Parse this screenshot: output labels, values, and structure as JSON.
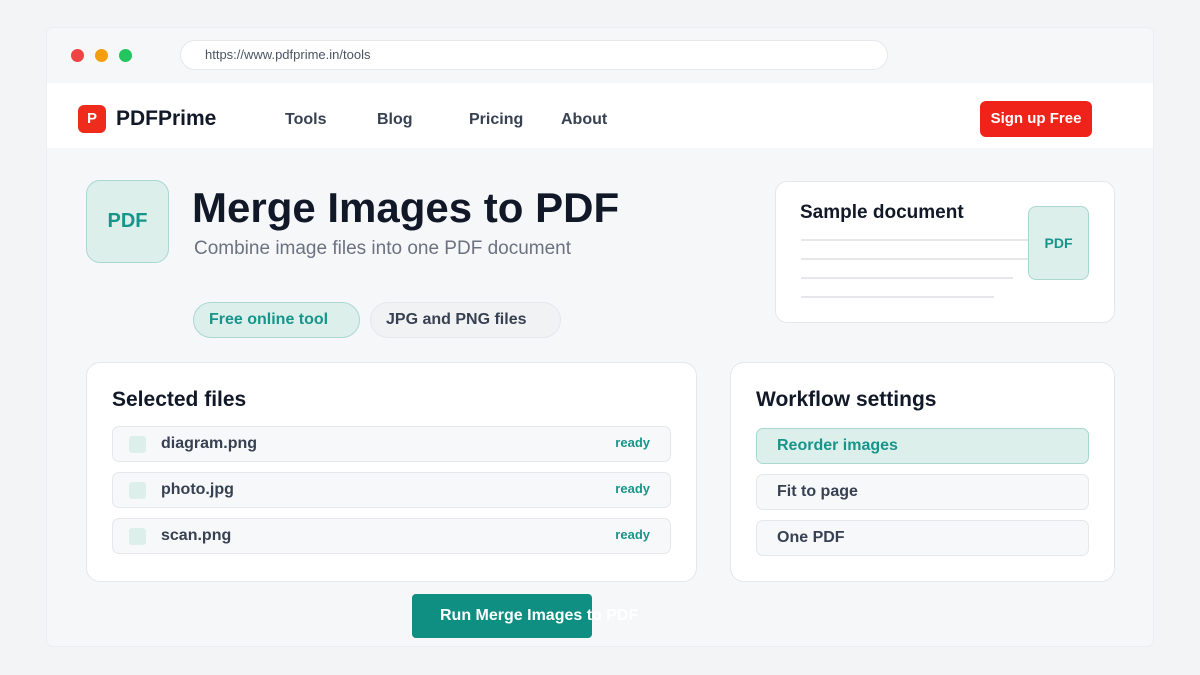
{
  "browser": {
    "url": "https://www.pdfprime.in/tools"
  },
  "header": {
    "logo_letter": "P",
    "brand": "PDFPrime",
    "nav": [
      {
        "label": "Tools"
      },
      {
        "label": "Blog"
      },
      {
        "label": "Pricing"
      },
      {
        "label": "About"
      }
    ],
    "signup_label": "Sign up Free"
  },
  "hero": {
    "badge": "PDF",
    "title": "Merge Images to PDF",
    "subtitle": "Combine image files into one PDF document",
    "chips": [
      "Free online tool",
      "JPG and PNG files"
    ]
  },
  "sample": {
    "title": "Sample document",
    "badge": "PDF"
  },
  "files": {
    "title": "Selected files",
    "items": [
      {
        "name": "diagram.png",
        "status": "ready"
      },
      {
        "name": "photo.jpg",
        "status": "ready"
      },
      {
        "name": "scan.png",
        "status": "ready"
      }
    ]
  },
  "settings": {
    "title": "Workflow settings",
    "options": [
      {
        "label": "Reorder images",
        "active": true
      },
      {
        "label": "Fit to page",
        "active": false
      },
      {
        "label": "One PDF",
        "active": false
      }
    ]
  },
  "action": {
    "run_label": "Run Merge Images to PDF"
  },
  "colors": {
    "brand_red": "#ef2b1c",
    "accent_teal": "#16958a",
    "button_teal": "#0f8f82",
    "tint_teal": "#dcefeb"
  }
}
